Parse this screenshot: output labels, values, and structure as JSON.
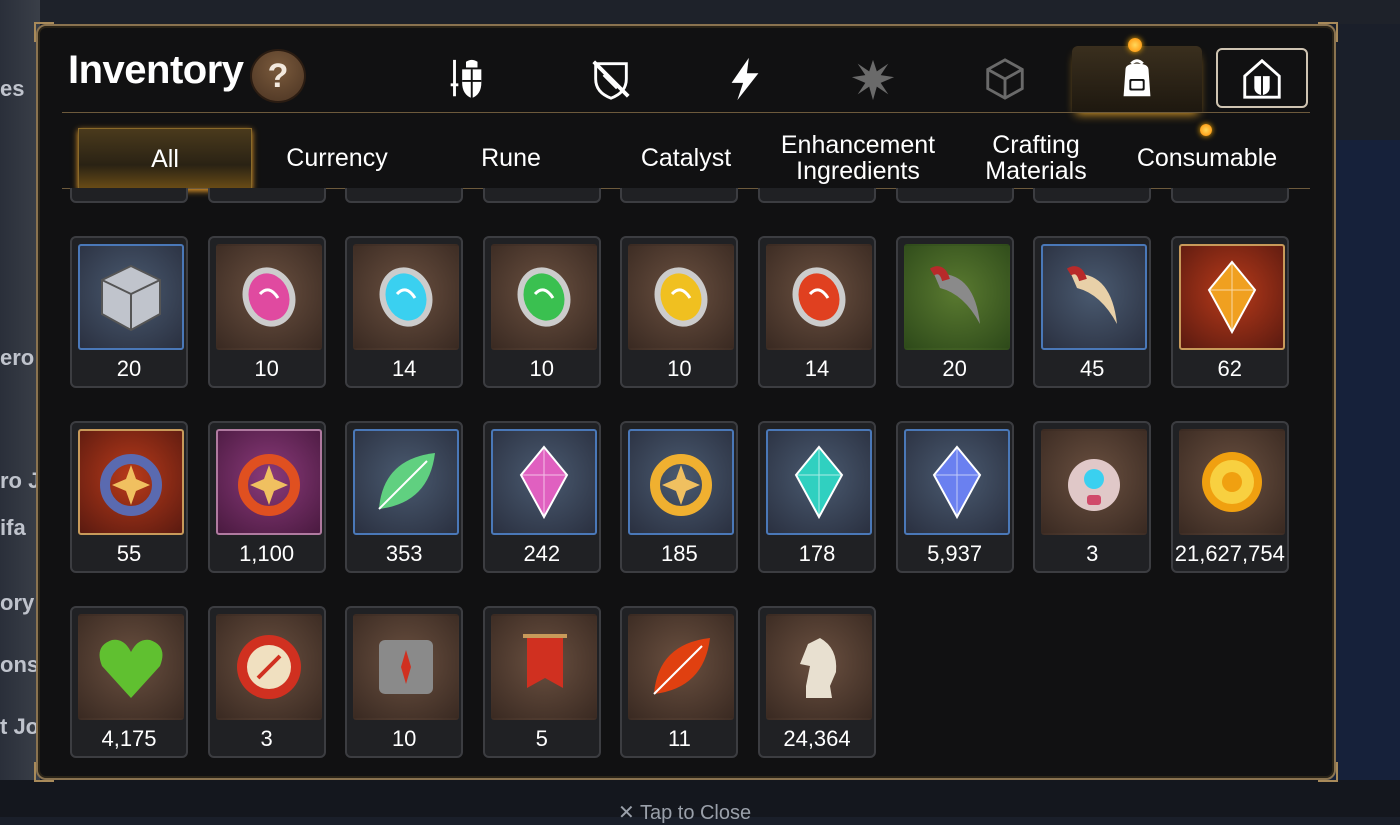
{
  "background": {
    "left_labels": [
      "es",
      "ero",
      "ro J",
      "ifa",
      "ory",
      "ons",
      "t Jo"
    ],
    "tap_to_close": "✕ Tap to Close"
  },
  "inventory": {
    "title": "Inventory",
    "help_label": "?",
    "category_tabs": [
      {
        "icon": "equipment-sword-shield-icon"
      },
      {
        "icon": "broken-shield-icon"
      },
      {
        "icon": "lightning-icon"
      },
      {
        "icon": "splash-icon"
      },
      {
        "icon": "crystal-cube-icon"
      },
      {
        "icon": "backpack-icon",
        "active": true,
        "notification": true
      },
      {
        "icon": "house-shield-icon"
      }
    ],
    "sub_tabs": [
      {
        "label": "All",
        "active": true
      },
      {
        "label": "Currency"
      },
      {
        "label": "Rune"
      },
      {
        "label": "Catalyst"
      },
      {
        "label": "Enhancement\nIngredients"
      },
      {
        "label": "Crafting\nMaterials"
      },
      {
        "label": "Consumable",
        "notification": true
      }
    ],
    "items": [
      {
        "name": "silver-box-icon",
        "count": "20",
        "frame": "blue",
        "color": "#c0c4cc"
      },
      {
        "name": "pink-rune-stone-icon",
        "count": "10",
        "frame": "brown",
        "color": "#e04aa0"
      },
      {
        "name": "cyan-rune-stone-icon",
        "count": "14",
        "frame": "brown",
        "color": "#3ad0f0"
      },
      {
        "name": "green-rune-stone-icon",
        "count": "10",
        "frame": "brown",
        "color": "#3ac050"
      },
      {
        "name": "yellow-rune-stone-icon",
        "count": "10",
        "frame": "brown",
        "color": "#f0c020"
      },
      {
        "name": "red-rune-stone-icon",
        "count": "14",
        "frame": "brown",
        "color": "#e04020"
      },
      {
        "name": "claw-icon",
        "count": "20",
        "frame": "green",
        "color": "#8a8a8a"
      },
      {
        "name": "herb-root-icon",
        "count": "45",
        "frame": "blue",
        "color": "#e8d0a8"
      },
      {
        "name": "golden-crystal-icon",
        "count": "62",
        "frame": "red",
        "color": "#f0a020"
      },
      {
        "name": "blue-ring-pendant-icon",
        "count": "55",
        "frame": "red",
        "color": "#5a6ab0"
      },
      {
        "name": "flame-bracelet-icon",
        "count": "1,100",
        "frame": "purple",
        "color": "#e05020"
      },
      {
        "name": "green-leaf-icon",
        "count": "353",
        "frame": "blue",
        "color": "#60d080"
      },
      {
        "name": "pink-mountain-crystal-icon",
        "count": "242",
        "frame": "blue",
        "color": "#e060c0"
      },
      {
        "name": "star-compass-pendant-icon",
        "count": "185",
        "frame": "blue",
        "color": "#f0b030"
      },
      {
        "name": "teal-crystal-icon",
        "count": "178",
        "frame": "blue",
        "color": "#30d0c0"
      },
      {
        "name": "blue-gem-icon",
        "count": "5,937",
        "frame": "blue",
        "color": "#6a80f0"
      },
      {
        "name": "robot-pod-icon",
        "count": "3",
        "frame": "brown",
        "color": "#e0c8c8"
      },
      {
        "name": "gold-sun-coin-icon",
        "count": "21,627,754",
        "frame": "brown",
        "color": "#f0a010"
      },
      {
        "name": "green-heart-icon",
        "count": "4,175",
        "frame": "brown",
        "color": "#60c030"
      },
      {
        "name": "red-seal-badge-icon",
        "count": "3",
        "frame": "brown",
        "color": "#d03020"
      },
      {
        "name": "stone-compass-cube-icon",
        "count": "10",
        "frame": "brown",
        "color": "#8a8a8a"
      },
      {
        "name": "red-banner-icon",
        "count": "5",
        "frame": "brown",
        "color": "#d03020"
      },
      {
        "name": "autumn-leaf-icon",
        "count": "11",
        "frame": "brown",
        "color": "#e04010"
      },
      {
        "name": "chess-knight-icon",
        "count": "24,364",
        "frame": "brown",
        "color": "#e8e0d0"
      }
    ]
  }
}
